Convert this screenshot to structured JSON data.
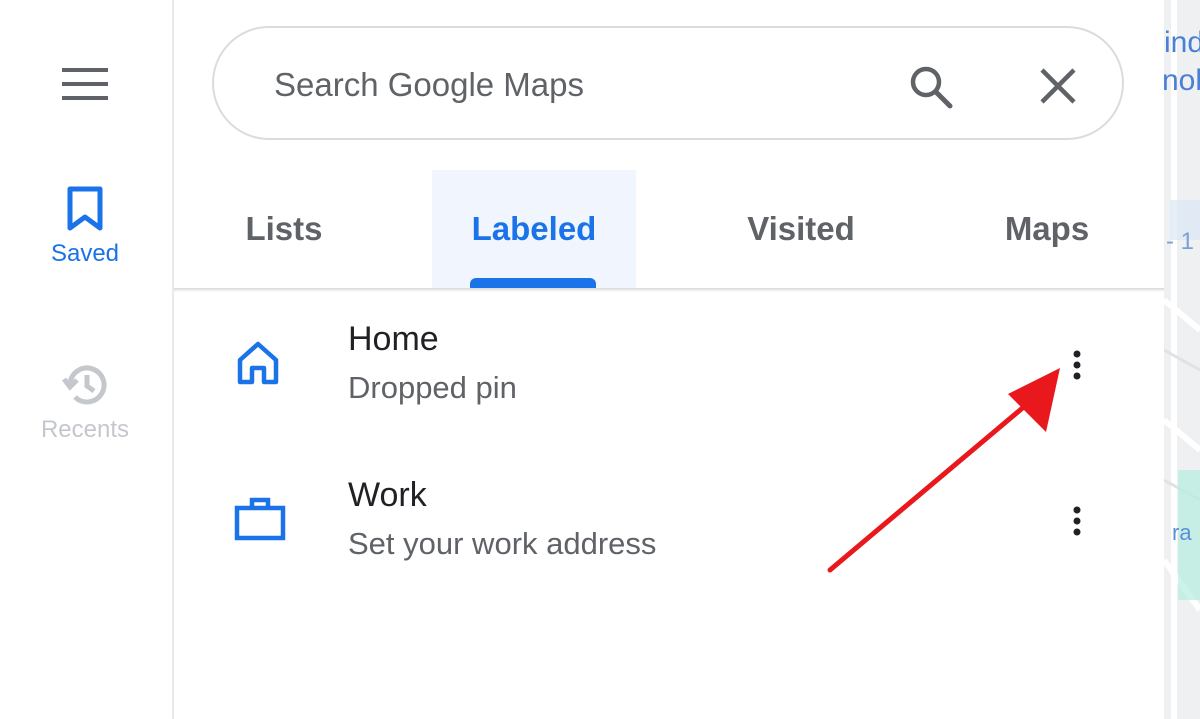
{
  "nav_rail": {
    "menu_icon": "hamburger-menu-icon",
    "items": [
      {
        "label": "Saved",
        "icon": "bookmark-icon",
        "active": true,
        "color": "#1a73e8"
      },
      {
        "label": "Recents",
        "icon": "history-icon",
        "active": false,
        "color": "#c4c7cc"
      }
    ]
  },
  "search": {
    "placeholder": "Search Google Maps",
    "value": "",
    "search_icon": "search-icon",
    "close_icon": "close-icon"
  },
  "tabs": [
    {
      "label": "Lists",
      "active": false
    },
    {
      "label": "Labeled",
      "active": true
    },
    {
      "label": "Visited",
      "active": false
    },
    {
      "label": "Maps",
      "active": false
    }
  ],
  "labeled_places": [
    {
      "title": "Home",
      "subtitle": "Dropped pin",
      "icon": "home-icon",
      "menu_icon": "more-vert-icon"
    },
    {
      "title": "Work",
      "subtitle": "Set your work address",
      "icon": "briefcase-icon",
      "menu_icon": "more-vert-icon"
    }
  ],
  "map_partial_text": {
    "line1": "ind",
    "line2": "nob",
    "line3": "- 1",
    "line4": "ra"
  },
  "colors": {
    "accent": "#1a73e8",
    "annotation_arrow": "#e8181c",
    "tab_active_bg": "#f1f5fd"
  }
}
